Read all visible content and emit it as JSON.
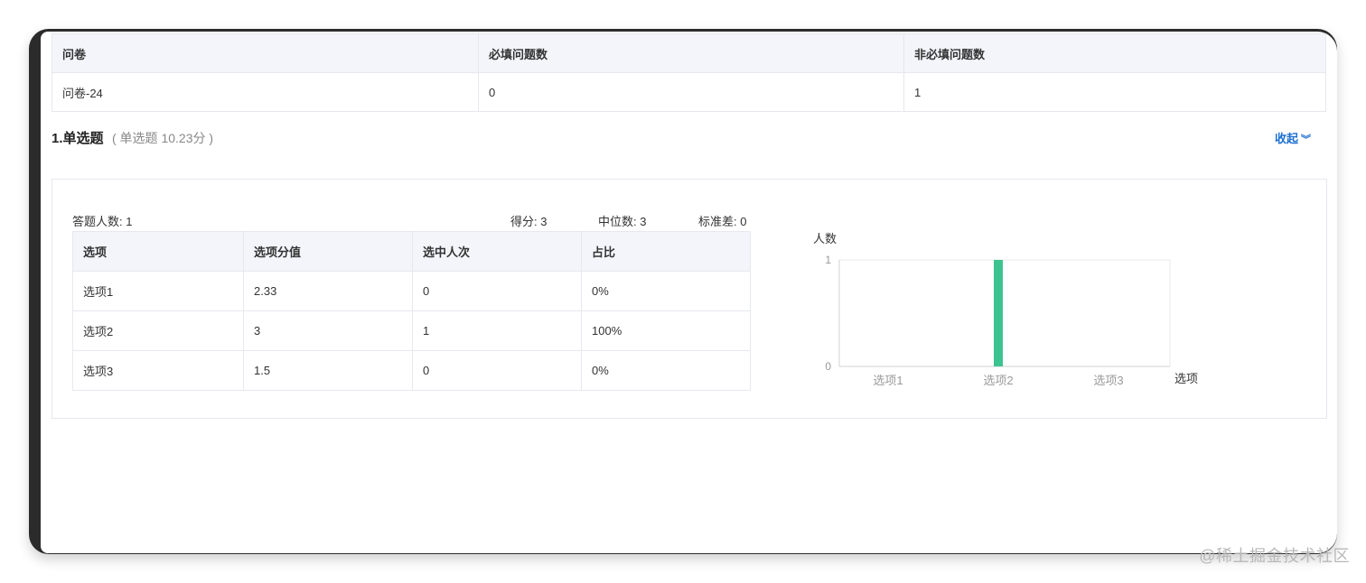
{
  "summary": {
    "headers": [
      "问卷",
      "必填问题数",
      "非必填问题数"
    ],
    "row": [
      "问卷-24",
      "0",
      "1"
    ]
  },
  "question": {
    "title": "1.单选题",
    "meta": "( 单选题 10.23分 )",
    "collapse_label": "收起",
    "collapse_icon": "double-chevron-down-icon"
  },
  "stats": {
    "respondents": "答题人数: 1",
    "score": "得分: 3",
    "median": "中位数: 3",
    "stddev": "标准差: 0"
  },
  "options_table": {
    "headers": [
      "选项",
      "选项分值",
      "选中人次",
      "占比"
    ],
    "rows": [
      [
        "选项1",
        "2.33",
        "0",
        "0%"
      ],
      [
        "选项2",
        "3",
        "1",
        "100%"
      ],
      [
        "选项3",
        "1.5",
        "0",
        "0%"
      ]
    ]
  },
  "chart_data": {
    "type": "bar",
    "categories": [
      "选项1",
      "选项2",
      "选项3"
    ],
    "values": [
      0,
      1,
      0
    ],
    "ylabel": "人数",
    "xlabel": "选项",
    "ylim": [
      0,
      1
    ],
    "yticks": [
      "0",
      "1"
    ],
    "bar_color": "#3cc390",
    "grid": false
  },
  "watermark": "@稀土掘金技术社区"
}
